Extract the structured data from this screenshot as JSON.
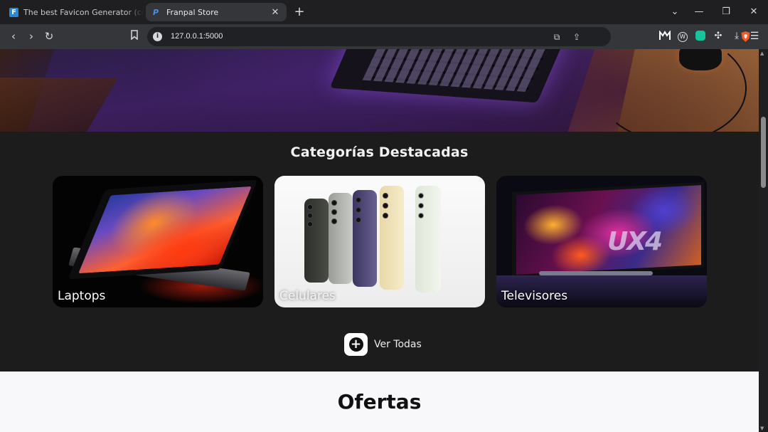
{
  "browser": {
    "tabs": [
      {
        "title": "The best Favicon Generator (completely free)",
        "favicon": "F",
        "active": false
      },
      {
        "title": "Franpal Store",
        "favicon": "P",
        "active": true
      }
    ],
    "url": "127.0.0.1:5000",
    "accent": "#35363a"
  },
  "page": {
    "categories_title": "Categorías Destacadas",
    "categories": [
      {
        "label": "Laptops"
      },
      {
        "label": "Celulares"
      },
      {
        "label": "Televisores"
      }
    ],
    "tv_logo": "UX4",
    "see_all_label": "Ver Todas",
    "offers_title": "Ofertas"
  }
}
